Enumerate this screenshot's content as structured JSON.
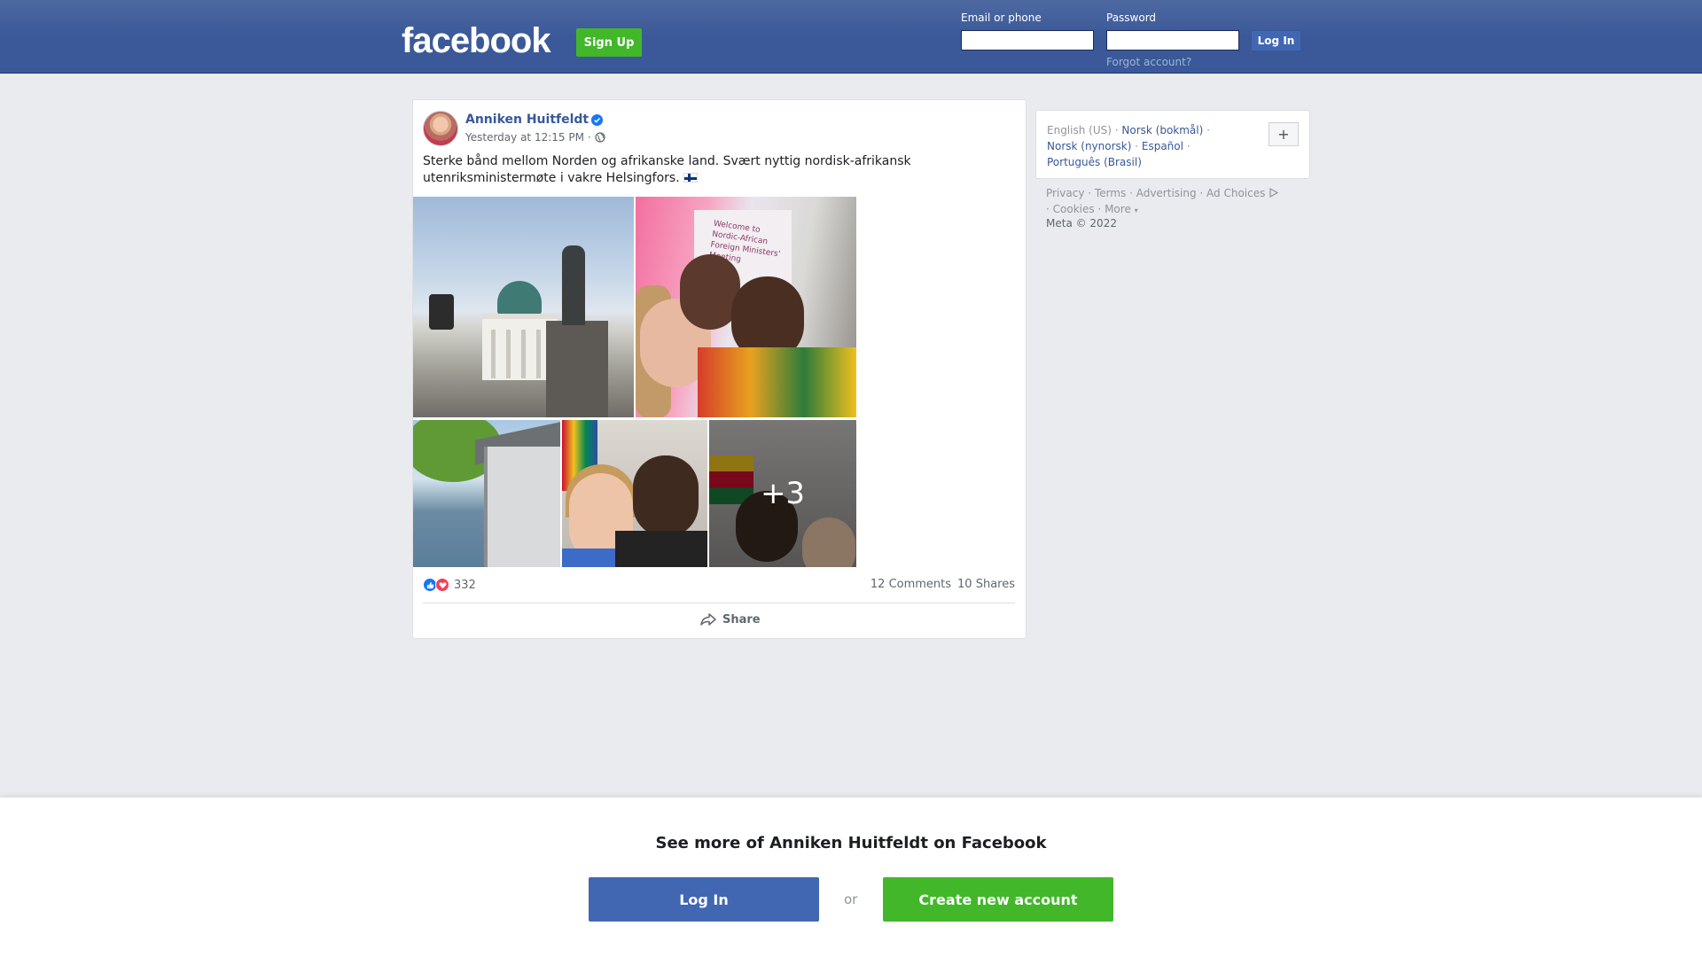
{
  "header": {
    "logo": "facebook",
    "signup_label": "Sign Up",
    "email_label": "Email or phone",
    "password_label": "Password",
    "login_label": "Log In",
    "forgot_label": "Forgot account?"
  },
  "post": {
    "author": "Anniken Huitfeldt",
    "timestamp": "Yesterday at 12:15 PM",
    "separator": "·",
    "text": "Sterke bånd mellom Norden og afrikanske land. Svært nyttig nordisk-afrikansk utenriksministermøte i vakre Helsingfors.",
    "screen_text": "Welcome to Nordic-African Foreign Ministers' Meeting",
    "more_photos": "+3",
    "reaction_count": "332",
    "comments": "12 Comments",
    "shares": "10 Shares",
    "share_label": "Share"
  },
  "languages": {
    "current": "English (US)",
    "options": [
      "Norsk (bokmål)",
      "Norsk (nynorsk)",
      "Español",
      "Português (Brasil)"
    ],
    "add_label": "+"
  },
  "footer": {
    "links": [
      "Privacy",
      "Terms",
      "Advertising",
      "Ad Choices",
      "Cookies",
      "More"
    ],
    "copyright": "Meta © 2022"
  },
  "banner": {
    "title": "See more of Anniken Huitfeldt on Facebook",
    "login_label": "Log In",
    "or_label": "or",
    "create_label": "Create new account"
  },
  "colors": {
    "brand_blue": "#4267b2",
    "header_blue": "#3b5998",
    "green": "#42b72a",
    "link": "#385898"
  }
}
